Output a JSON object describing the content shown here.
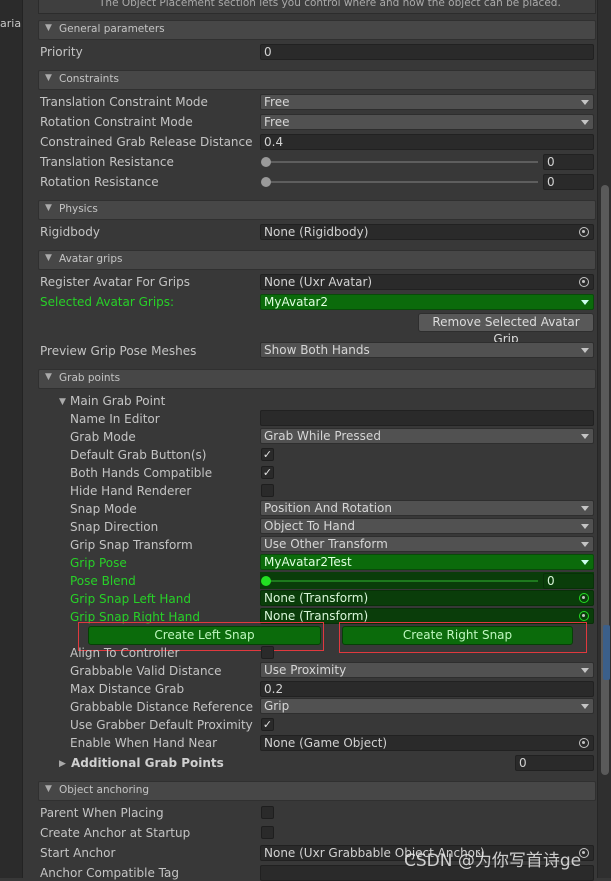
{
  "top_text": "The Object Placement section lets you control where and how the object can be placed.",
  "left_stub": "aria",
  "sections": {
    "general": "General parameters",
    "constraints": "Constraints",
    "physics": "Physics",
    "avatar": "Avatar grips",
    "grab": "Grab points",
    "anchoring": "Object anchoring"
  },
  "fields": {
    "priority": {
      "label": "Priority",
      "value": "0"
    },
    "trans_constraint": {
      "label": "Translation Constraint Mode",
      "value": "Free"
    },
    "rot_constraint": {
      "label": "Rotation Constraint Mode",
      "value": "Free"
    },
    "release_dist": {
      "label": "Constrained Grab Release Distance",
      "value": "0.4"
    },
    "trans_resist": {
      "label": "Translation Resistance",
      "value": "0"
    },
    "rot_resist": {
      "label": "Rotation Resistance",
      "value": "0"
    },
    "rigidbody": {
      "label": "Rigidbody",
      "value": "None (Rigidbody)"
    },
    "register_avatar": {
      "label": "Register Avatar For Grips",
      "value": "None (Uxr Avatar)"
    },
    "selected_grips": {
      "label": "Selected Avatar Grips:",
      "value": "MyAvatar2"
    },
    "remove_grip_btn": "Remove Selected Avatar Grip",
    "preview_meshes": {
      "label": "Preview Grip Pose Meshes",
      "value": "Show Both Hands"
    },
    "main_grab_point": "Main Grab Point",
    "name_in_editor": {
      "label": "Name In Editor",
      "value": ""
    },
    "grab_mode": {
      "label": "Grab Mode",
      "value": "Grab While Pressed"
    },
    "default_grab_buttons": {
      "label": "Default Grab Button(s)",
      "value": "✓"
    },
    "both_hands": {
      "label": "Both Hands Compatible",
      "value": "✓"
    },
    "hide_hand": {
      "label": "Hide Hand Renderer",
      "value": ""
    },
    "snap_mode": {
      "label": "Snap Mode",
      "value": "Position And Rotation"
    },
    "snap_direction": {
      "label": "Snap Direction",
      "value": "Object To Hand"
    },
    "grip_snap_transform": {
      "label": "Grip Snap Transform",
      "value": "Use Other Transform"
    },
    "grip_pose": {
      "label": "Grip Pose",
      "value": "MyAvatar2Test"
    },
    "pose_blend": {
      "label": "Pose Blend",
      "value": "0"
    },
    "snap_left": {
      "label": "Grip Snap Left Hand",
      "value": "None (Transform)"
    },
    "snap_right": {
      "label": "Grip Snap Right Hand",
      "value": "None (Transform)"
    },
    "create_left": "Create Left Snap",
    "create_right": "Create Right Snap",
    "align_controller": {
      "label": "Align To Controller",
      "value": ""
    },
    "valid_distance": {
      "label": "Grabbable Valid Distance",
      "value": "Use Proximity"
    },
    "max_distance": {
      "label": "Max Distance Grab",
      "value": "0.2"
    },
    "distance_ref": {
      "label": "Grabbable Distance Reference",
      "value": "Grip"
    },
    "default_proximity": {
      "label": "Use Grabber Default Proximity",
      "value": "✓"
    },
    "enable_near": {
      "label": "Enable When Hand Near",
      "value": "None (Game Object)"
    },
    "additional_points": {
      "label": "Additional Grab Points",
      "value": "0"
    },
    "parent_placing": {
      "label": "Parent When Placing",
      "value": ""
    },
    "create_anchor": {
      "label": "Create Anchor at Startup",
      "value": ""
    },
    "start_anchor": {
      "label": "Start Anchor",
      "value": "None (Uxr Grabbable Object Anchor)"
    },
    "anchor_tag": {
      "label": "Anchor Compatible Tag",
      "value": ""
    }
  },
  "watermark": "CSDN @为你写首诗ge",
  "colors": {
    "highlight_green": "#27d127",
    "green_field": "#0b6b0b",
    "red_outline": "#e0393e"
  }
}
